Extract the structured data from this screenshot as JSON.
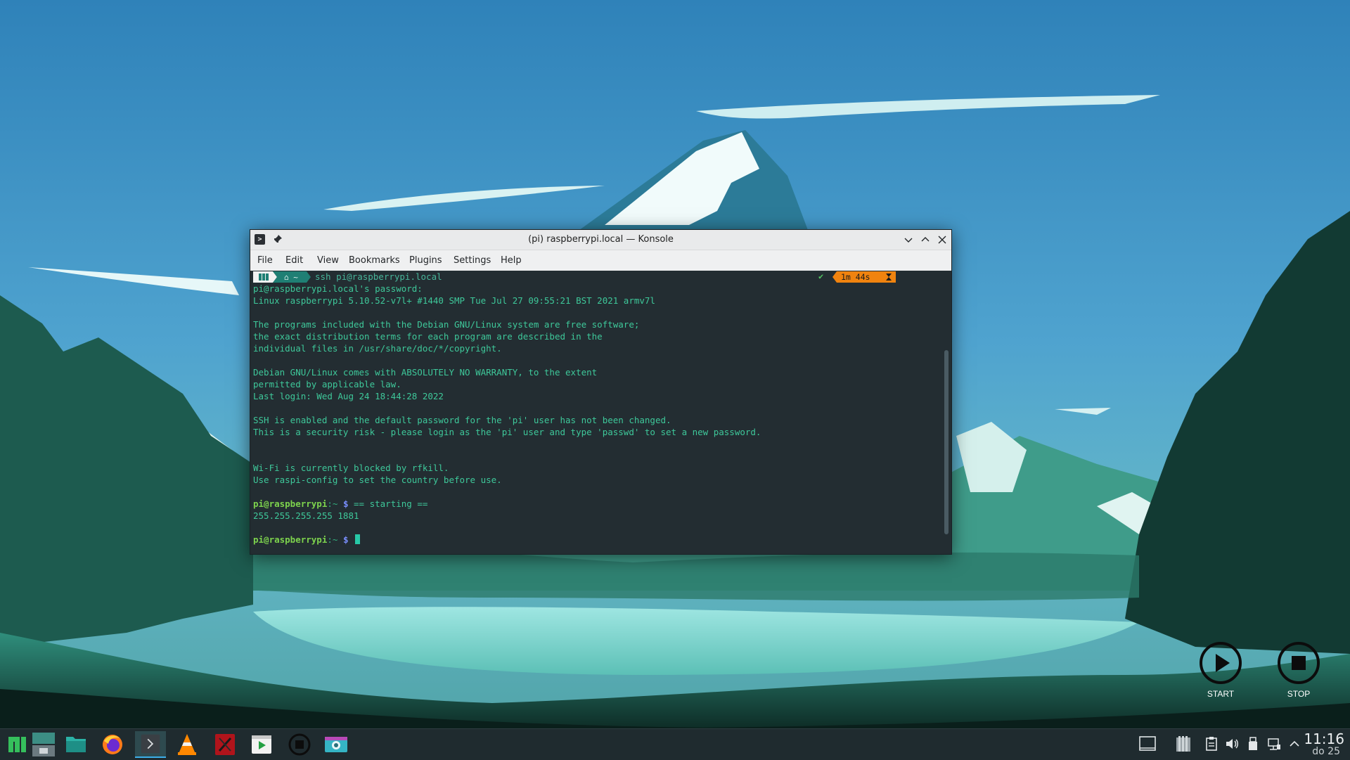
{
  "window": {
    "title": "(pi) raspberrypi.local — Konsole",
    "menu": [
      "File",
      "Edit",
      "View",
      "Bookmarks",
      "Plugins",
      "Settings",
      "Help"
    ]
  },
  "terminal": {
    "command": "ssh pi@raspberrypi.local",
    "timer": "1m 44s",
    "lines": {
      "l1": "pi@raspberrypi.local's password:",
      "l2": "Linux raspberrypi 5.10.52-v7l+ #1440 SMP Tue Jul 27 09:55:21 BST 2021 armv7l",
      "l3": "The programs included with the Debian GNU/Linux system are free software;",
      "l4": "the exact distribution terms for each program are described in the",
      "l5": "individual files in /usr/share/doc/*/copyright.",
      "l6": "Debian GNU/Linux comes with ABSOLUTELY NO WARRANTY, to the extent",
      "l7": "permitted by applicable law.",
      "l8": "Last login: Wed Aug 24 18:44:28 2022",
      "l9": "SSH is enabled and the default password for the 'pi' user has not been changed.",
      "l10": "This is a security risk - please login as the 'pi' user and type 'passwd' to set a new password.",
      "l11": "Wi-Fi is currently blocked by rfkill.",
      "l12": "Use raspi-config to set the country before use.",
      "l13_cmd": "== starting ==",
      "l14": "255.255.255.255 1881"
    },
    "prompt_user": "pi@raspberrypi",
    "prompt_path": ":~",
    "prompt_sign": "$"
  },
  "desktop": {
    "start_label": "START",
    "stop_label": "STOP"
  },
  "taskbar": {
    "clock_time": "11:16",
    "clock_date": "do 25"
  },
  "colors": {
    "terminal_bg": "#232d32",
    "terminal_text": "#3ec89a",
    "accent": "#3daee9",
    "timer_badge": "#f0830f"
  }
}
